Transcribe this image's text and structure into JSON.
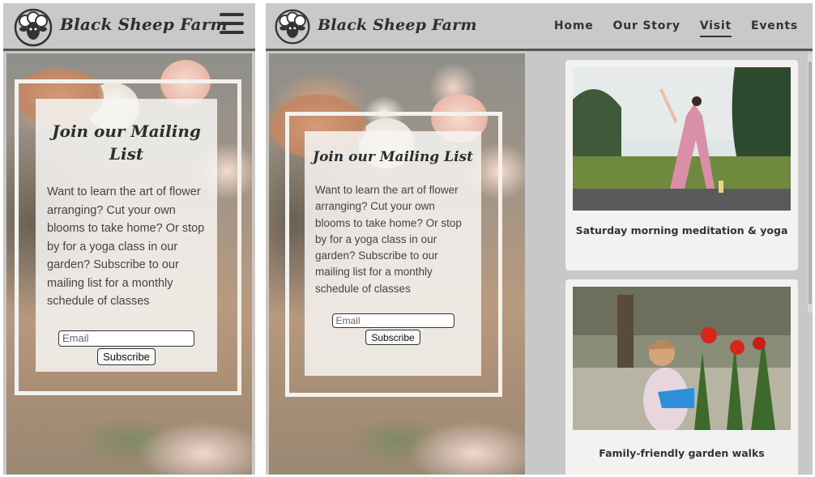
{
  "site": {
    "brand": "Black Sheep Farm",
    "logo_icon": "sheep-logo-icon"
  },
  "nav": {
    "items": [
      {
        "label": "Home"
      },
      {
        "label": "Our Story"
      },
      {
        "label": "Visit",
        "active": true
      },
      {
        "label": "Events"
      }
    ],
    "menu_icon": "hamburger-menu-icon"
  },
  "signup": {
    "title": "Join our Mailing List",
    "body": "Want to learn the art of flower arranging? Cut your own blooms to take home? Or stop by for a yoga class in our garden? Subscribe to our mailing list for a monthly schedule of classes",
    "email_placeholder": "Email",
    "submit_label": "Subscribe"
  },
  "events": [
    {
      "title": "Saturday morning meditation & yoga",
      "image": "yoga-photo"
    },
    {
      "title": "Family-friendly garden walks",
      "image": "garden-walk-photo"
    }
  ],
  "colors": {
    "header_bg": "#c9c9c9",
    "page_bg": "#c8c8c8",
    "card_bg": "#f3f2f1",
    "text": "#333333"
  }
}
